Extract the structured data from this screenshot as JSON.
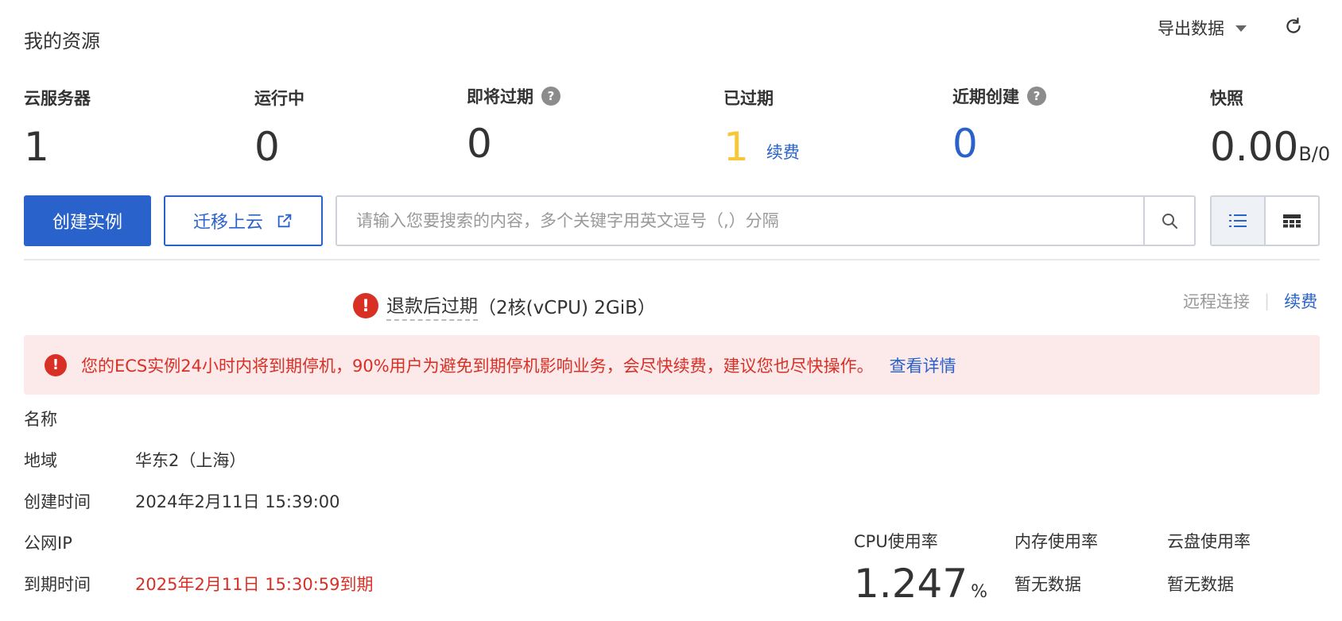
{
  "header": {
    "title": "我的资源",
    "export_label": "导出数据",
    "refresh_icon": "refresh-icon"
  },
  "stats": {
    "servers": {
      "label": "云服务器",
      "value": "1"
    },
    "running": {
      "label": "运行中",
      "value": "0"
    },
    "expiring": {
      "label": "即将过期",
      "value": "0",
      "help": "?"
    },
    "expired": {
      "label": "已过期",
      "value": "1",
      "action": "续费"
    },
    "recent": {
      "label": "近期创建",
      "value": "0",
      "help": "?"
    },
    "snapshot": {
      "label": "快照",
      "value": "0.00",
      "unit": "B/0"
    }
  },
  "toolbar": {
    "create_label": "创建实例",
    "migrate_label": "迁移上云",
    "search_placeholder": "请输入您要搜索的内容，多个关键字用英文逗号（,）分隔"
  },
  "instance": {
    "status_text": "退款后过期",
    "spec": "（2核(vCPU) 2GiB）",
    "actions": {
      "remote": "远程连接",
      "renew": "续费"
    }
  },
  "alert": {
    "icon": "!",
    "text": "您的ECS实例24小时内将到期停机，90%用户为避免到期停机影响业务，会尽快续费，建议您也尽快操作。",
    "link": "查看详情"
  },
  "details": {
    "name_label": "名称",
    "name_value": "",
    "region_label": "地域",
    "region_value": "华东2（上海）",
    "created_label": "创建时间",
    "created_value": "2024年2月11日 15:39:00",
    "ip_label": "公网IP",
    "ip_value": "",
    "expire_label": "到期时间",
    "expire_value": "2025年2月11日 15:30:59到期"
  },
  "metrics": {
    "cpu": {
      "label": "CPU使用率",
      "value": "1.247",
      "unit": "%"
    },
    "mem": {
      "label": "内存使用率",
      "value": "暂无数据"
    },
    "disk": {
      "label": "云盘使用率",
      "value": "暂无数据"
    }
  },
  "colors": {
    "primary": "#2962ca",
    "warning_yellow": "#f7c738",
    "danger": "#d93026",
    "alert_bg": "#fce9e9"
  }
}
